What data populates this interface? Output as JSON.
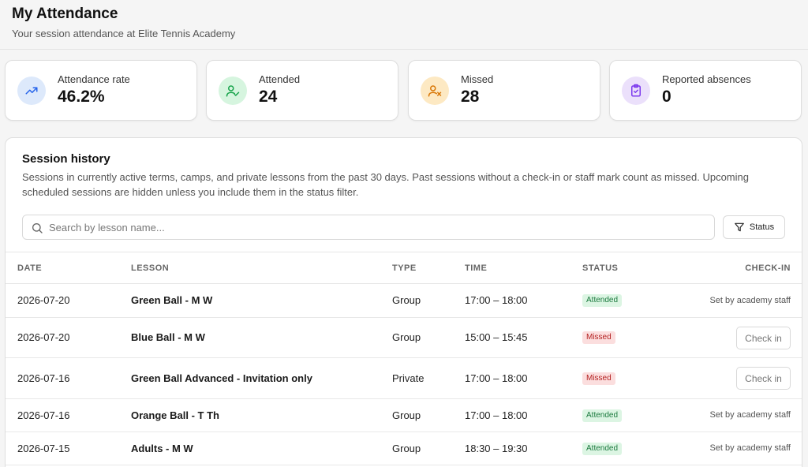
{
  "header": {
    "title": "My Attendance",
    "subtitle": "Your session attendance at Elite Tennis Academy"
  },
  "stats": [
    {
      "label": "Attendance rate",
      "value": "46.2%",
      "icon": "trending-up-icon",
      "color": "#2563eb",
      "bg": "#dde9fb"
    },
    {
      "label": "Attended",
      "value": "24",
      "icon": "user-check-icon",
      "color": "#16a34a",
      "bg": "#d6f5df"
    },
    {
      "label": "Missed",
      "value": "28",
      "icon": "user-x-icon",
      "color": "#d97706",
      "bg": "#fde9c3"
    },
    {
      "label": "Reported absences",
      "value": "0",
      "icon": "clipboard-check-icon",
      "color": "#7c3aed",
      "bg": "#ebe0fb"
    }
  ],
  "history": {
    "title": "Session history",
    "description": "Sessions in currently active terms, camps, and private lessons from the past 30 days. Past sessions without a check-in or staff mark count as missed. Upcoming scheduled sessions are hidden unless you include them in the status filter.",
    "search_placeholder": "Search by lesson name...",
    "status_button": "Status",
    "columns": {
      "date": "DATE",
      "lesson": "LESSON",
      "type": "TYPE",
      "time": "TIME",
      "status": "STATUS",
      "checkin": "CHECK-IN"
    },
    "rows": [
      {
        "date": "2026-07-20",
        "lesson": "Green Ball - M W",
        "type": "Group",
        "time": "17:00 – 18:00",
        "status": "Attended",
        "checkin": "Set by academy staff"
      },
      {
        "date": "2026-07-20",
        "lesson": "Blue Ball - M W",
        "type": "Group",
        "time": "15:00 – 15:45",
        "status": "Missed",
        "checkin": "Check in"
      },
      {
        "date": "2026-07-16",
        "lesson": "Green Ball Advanced - Invitation only",
        "type": "Private",
        "time": "17:00 – 18:00",
        "status": "Missed",
        "checkin": "Check in"
      },
      {
        "date": "2026-07-16",
        "lesson": "Orange Ball - T Th",
        "type": "Group",
        "time": "17:00 – 18:00",
        "status": "Attended",
        "checkin": "Set by academy staff"
      },
      {
        "date": "2026-07-15",
        "lesson": "Adults - M W",
        "type": "Group",
        "time": "18:30 – 19:30",
        "status": "Attended",
        "checkin": "Set by academy staff"
      }
    ]
  }
}
